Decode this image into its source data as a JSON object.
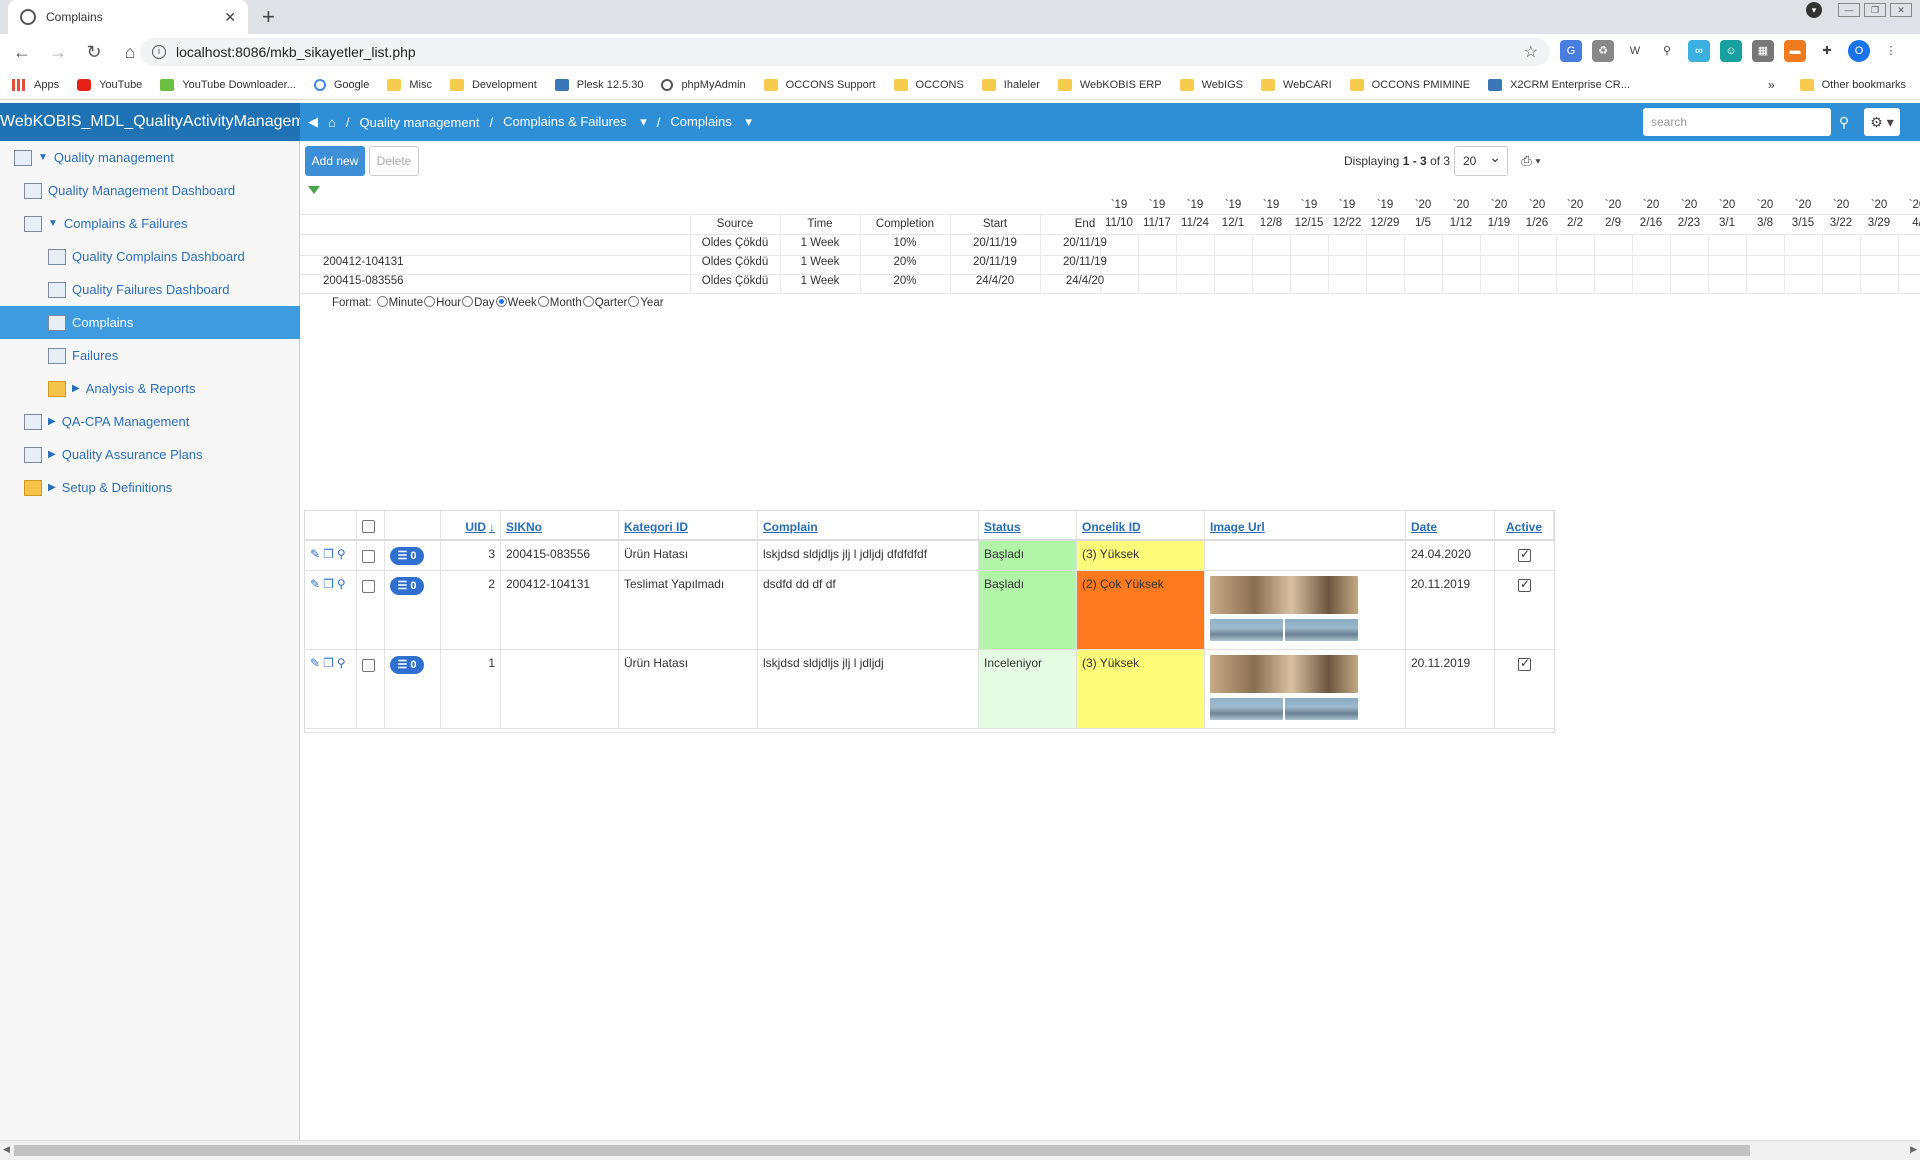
{
  "browser": {
    "tab_title": "Complains",
    "url": "localhost:8086/mkb_sikayetler_list.php",
    "bookmarks": [
      "Apps",
      "YouTube",
      "YouTube Downloader...",
      "Google",
      "Misc",
      "Development",
      "Plesk 12.5.30",
      "phpMyAdmin",
      "OCCONS Support",
      "OCCONS",
      "Ihaleler",
      "WebKOBIS ERP",
      "WebIGS",
      "WebCARI",
      "OCCONS PMIMINE",
      "X2CRM Enterprise CR..."
    ],
    "bookmarks_more": "»",
    "other_bookmarks": "Other bookmarks",
    "profile_initial": "O"
  },
  "header": {
    "app_title": "WebKOBIS_MDL_QualityActivityManagement",
    "breadcrumbs": [
      "Quality management",
      "Complains & Failures",
      "Complains"
    ],
    "search_placeholder": "search"
  },
  "sidebar": {
    "items": [
      {
        "label": "Quality management"
      },
      {
        "label": "Quality Management Dashboard"
      },
      {
        "label": "Complains & Failures"
      },
      {
        "label": "Quality Complains Dashboard"
      },
      {
        "label": "Quality Failures Dashboard"
      },
      {
        "label": "Complains"
      },
      {
        "label": "Failures"
      },
      {
        "label": "Analysis & Reports"
      },
      {
        "label": "QA-CPA Management"
      },
      {
        "label": "Quality Assurance Plans"
      },
      {
        "label": "Setup & Definitions"
      }
    ]
  },
  "toolbar": {
    "add_label": "Add new",
    "delete_label": "Delete",
    "displaying_prefix": "Displaying",
    "displaying_range": "1 - 3",
    "displaying_of": "of 3",
    "page_size": "20"
  },
  "gantt": {
    "columns": [
      "Source",
      "Time",
      "Completion",
      "Start",
      "End"
    ],
    "week_years": [
      "`19",
      "`19",
      "`19",
      "`19",
      "`19",
      "`19",
      "`19",
      "`19",
      "`20",
      "`20",
      "`20",
      "`20",
      "`20",
      "`20",
      "`20",
      "`20",
      "`20",
      "`20",
      "`20",
      "`20",
      "`20",
      "`20"
    ],
    "week_dates": [
      "11/10",
      "11/17",
      "11/24",
      "12/1",
      "12/8",
      "12/15",
      "12/22",
      "12/29",
      "1/5",
      "1/12",
      "1/19",
      "1/26",
      "2/2",
      "2/9",
      "2/16",
      "2/23",
      "3/1",
      "3/8",
      "3/15",
      "3/22",
      "3/29",
      "4/"
    ],
    "week_last_year": "`2",
    "rows": [
      {
        "name": "",
        "source": "Oldes Çökdü",
        "time": "1 Week",
        "completion": "10%",
        "start": "20/11/19",
        "end": "20/11/19"
      },
      {
        "name": "200412-104131",
        "source": "Oldes Çökdü",
        "time": "1 Week",
        "completion": "20%",
        "start": "20/11/19",
        "end": "20/11/19"
      },
      {
        "name": "200415-083556",
        "source": "Oldes Çökdü",
        "time": "1 Week",
        "completion": "20%",
        "start": "24/4/20",
        "end": "24/4/20"
      }
    ],
    "format_label": "Format:",
    "formats": [
      "Minute",
      "Hour",
      "Day",
      "Week",
      "Month",
      "Qarter",
      "Year"
    ],
    "format_selected": "Week"
  },
  "table": {
    "headers": [
      "UID",
      "SIKNo",
      "Kategori ID",
      "Complain",
      "Status",
      "Oncelik ID",
      "Image Url",
      "Date",
      "Active"
    ],
    "sort_indicator": "↓",
    "rows": [
      {
        "badge": "0",
        "uid": "3",
        "sikno": "200415-083556",
        "kategori": "Ürün Hatası",
        "complain": "lskjdsd sldjdljs jlj l jdljdj dfdfdfdf",
        "status": "Başladı",
        "status_color": "#b2f5a8",
        "oncelik": "(3) Yüksek",
        "oncelik_color": "#fffb7a",
        "date": "24.04.2020",
        "active": true
      },
      {
        "badge": "0",
        "uid": "2",
        "sikno": "200412-104131",
        "kategori": "Teslimat Yapılmadı",
        "complain": "dsdfd dd df df",
        "status": "Başladı",
        "status_color": "#b2f5a8",
        "oncelik": "(2) Çok Yüksek",
        "oncelik_color": "#ff7a1f",
        "date": "20.11.2019",
        "active": true
      },
      {
        "badge": "0",
        "uid": "1",
        "sikno": "",
        "kategori": "Ürün Hatası",
        "complain": "lskjdsd sldjdljs jlj l jdljdj",
        "status": "Inceleniyor",
        "status_color": "#e6fbe4",
        "oncelik": "(3) Yüksek",
        "oncelik_color": "#fffb7a",
        "date": "20.11.2019",
        "active": true
      }
    ]
  },
  "colors": {
    "header_blue": "#2f8fd6",
    "active_nav": "#3e9be0",
    "link_blue": "#2a6ebb"
  }
}
